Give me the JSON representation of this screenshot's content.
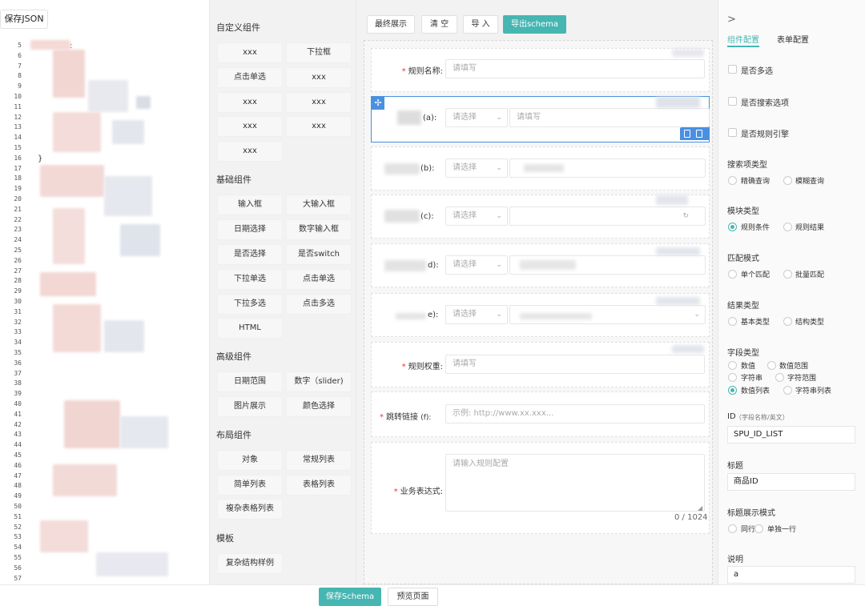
{
  "editor": {
    "save_label": "保存JSON",
    "line_numbers": [
      "5",
      "6",
      "7",
      "8",
      "9",
      "10",
      "11",
      "12",
      "13",
      "14",
      "15",
      "16",
      "17",
      "18",
      "19",
      "20",
      "21",
      "22",
      "23",
      "24",
      "25",
      "26",
      "27",
      "28",
      "29",
      "30",
      "31",
      "32",
      "33",
      "34",
      "35",
      "36",
      "37",
      "38",
      "39",
      "40",
      "41",
      "42",
      "43",
      "44",
      "45",
      "46",
      "47",
      "48",
      "49",
      "50",
      "51",
      "52",
      "53",
      "54",
      "55",
      "56",
      "57"
    ],
    "code_glyphs": [
      ":",
      "}"
    ]
  },
  "palette": {
    "sections": [
      {
        "title": "自定义组件",
        "items": [
          "xxx",
          "下拉框",
          "点击单选",
          "xxx",
          "xxx",
          "xxx",
          "xxx",
          "xxx",
          "xxx"
        ]
      },
      {
        "title": "基础组件",
        "items": [
          "输入框",
          "大输入框",
          "日期选择",
          "数字输入框",
          "是否选择",
          "是否switch",
          "下拉单选",
          "点击单选",
          "下拉多选",
          "点击多选",
          "HTML"
        ]
      },
      {
        "title": "高级组件",
        "items": [
          "日期范围",
          "数字（slider)",
          "图片展示",
          "颜色选择"
        ]
      },
      {
        "title": "布局组件",
        "items": [
          "对象",
          "常规列表",
          "简单列表",
          "表格列表",
          "複杂表格列表"
        ]
      },
      {
        "title": "模板",
        "items": [
          "复杂结构样例"
        ]
      }
    ]
  },
  "toolbar": {
    "final_display": "最终展示",
    "clear": "清 空",
    "import": "导 入",
    "export_schema": "导出schema"
  },
  "form": {
    "rule_name": {
      "label": "规则名称:",
      "placeholder": "请填写"
    },
    "field_a": {
      "label": "(a):",
      "select_placeholder": "请选择",
      "input_placeholder": "请填写"
    },
    "field_b": {
      "label": "(b):",
      "select_placeholder": "请选择"
    },
    "field_c": {
      "label": "(c):",
      "select_placeholder": "请选择"
    },
    "field_d": {
      "label": "d):",
      "select_placeholder": "请选择"
    },
    "field_e": {
      "label": "e):",
      "select_placeholder": "请选择"
    },
    "rule_weight": {
      "label": "规则权重:",
      "placeholder": "请填写"
    },
    "jump_link": {
      "label": "跳转链接",
      "suffix": "(f):",
      "placeholder": "示例: http://www.xx.xxx..."
    },
    "biz_expression": {
      "label": "业务表达式:",
      "placeholder": "请输入规则配置",
      "counter": "0 / 1024"
    }
  },
  "config": {
    "expand_glyph": ">",
    "tabs": [
      "组件配置",
      "表单配置"
    ],
    "checkboxes": [
      "是否多选",
      "是否搜索选项",
      "是否规则引擎"
    ],
    "search_type": {
      "title": "搜索项类型",
      "options": [
        "精确查询",
        "模糊查询"
      ]
    },
    "module_type": {
      "title": "模块类型",
      "options": [
        "规则条件",
        "规则结果"
      ],
      "selected": "规则条件"
    },
    "match_mode": {
      "title": "匹配模式",
      "options": [
        "单个匹配",
        "批量匹配"
      ]
    },
    "result_type": {
      "title": "结果类型",
      "options": [
        "基本类型",
        "结构类型"
      ]
    },
    "field_type": {
      "title": "字段类型",
      "options": [
        "数值",
        "数值范围",
        "字符串",
        "字符范围",
        "数值列表",
        "字符串列表"
      ],
      "selected": "数值列表"
    },
    "id": {
      "title": "ID",
      "hint": "（字段名称/英文）",
      "value": "SPU_ID_LIST"
    },
    "title_field": {
      "title": "标题",
      "value": "商品ID"
    },
    "title_display": {
      "title": "标题展示模式",
      "options": [
        "同行",
        "单独一行"
      ]
    },
    "description": {
      "title": "说明",
      "value": "a"
    }
  },
  "bottom": {
    "save_schema": "保存Schema",
    "preview": "预览页面"
  },
  "colors": {
    "accent": "#46b6b2",
    "required": "#e33333",
    "active_border": "#4a90e2"
  }
}
